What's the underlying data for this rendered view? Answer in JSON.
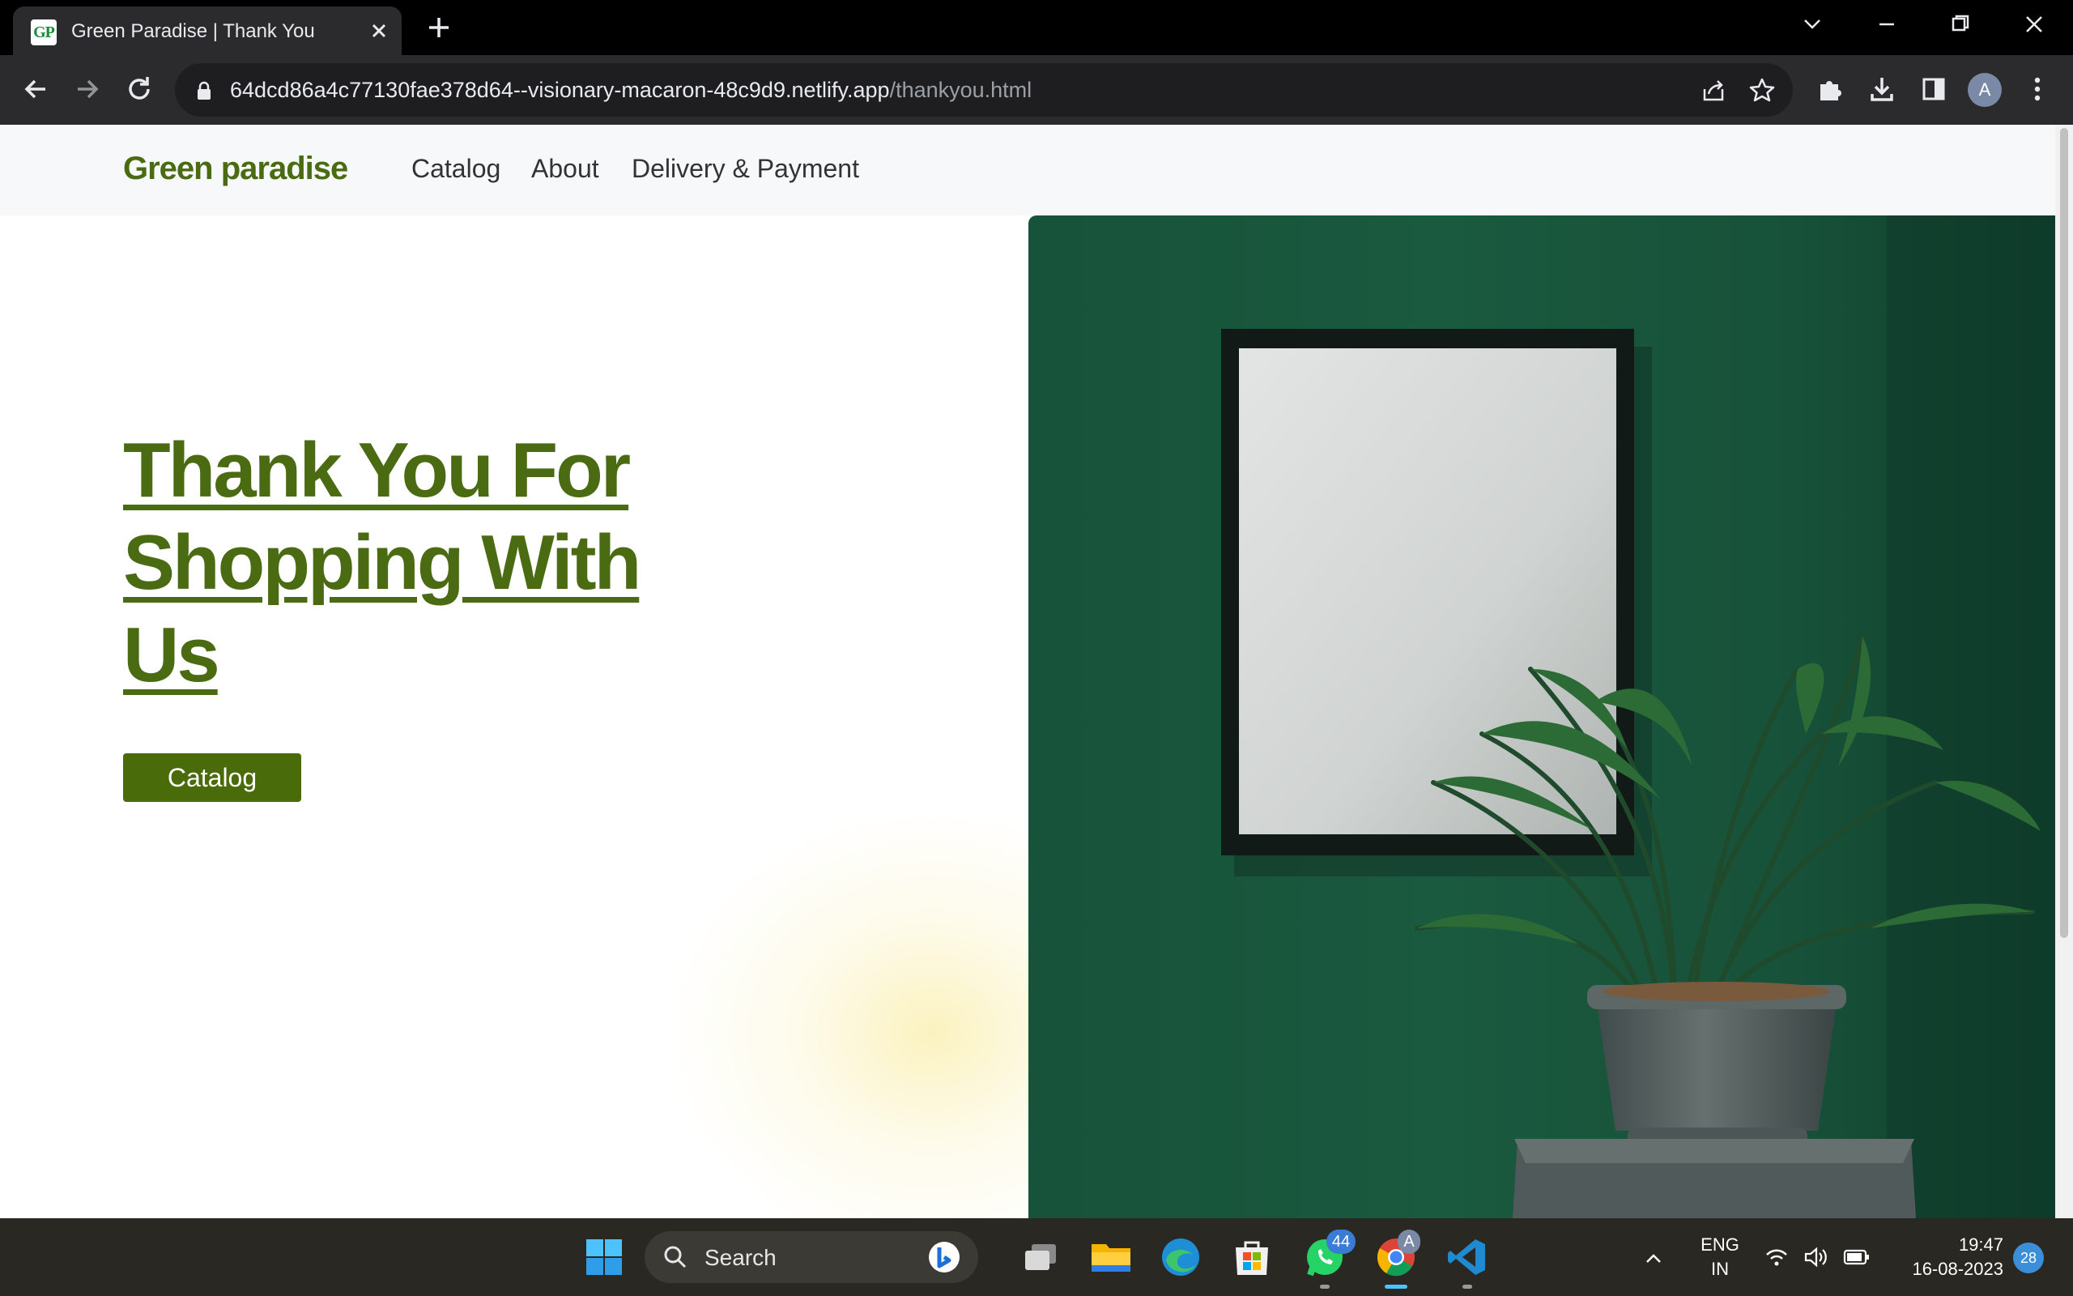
{
  "browser": {
    "tab_title": "Green Paradise | Thank You",
    "favicon_text": "GP",
    "url_host": "64dcd86a4c77130fae378d64--visionary-macaron-48c9d9.netlify.app",
    "url_path": "/thankyou.html",
    "profile_initial": "A"
  },
  "site": {
    "logo": "Green paradise",
    "nav": [
      "Catalog",
      "About",
      "Delivery & Payment"
    ],
    "hero_line1": "Thank You For",
    "hero_line2": "Shopping With",
    "hero_line3": "Us",
    "hero_button": "Catalog",
    "brand_color": "#4a6b12",
    "photo_wall_color": "#17523a"
  },
  "taskbar": {
    "search_placeholder": "Search",
    "whatsapp_badge": "44",
    "chrome_badge": "A",
    "lang_line1": "ENG",
    "lang_line2": "IN",
    "time": "19:47",
    "date": "16-08-2023",
    "notifications": "28"
  }
}
